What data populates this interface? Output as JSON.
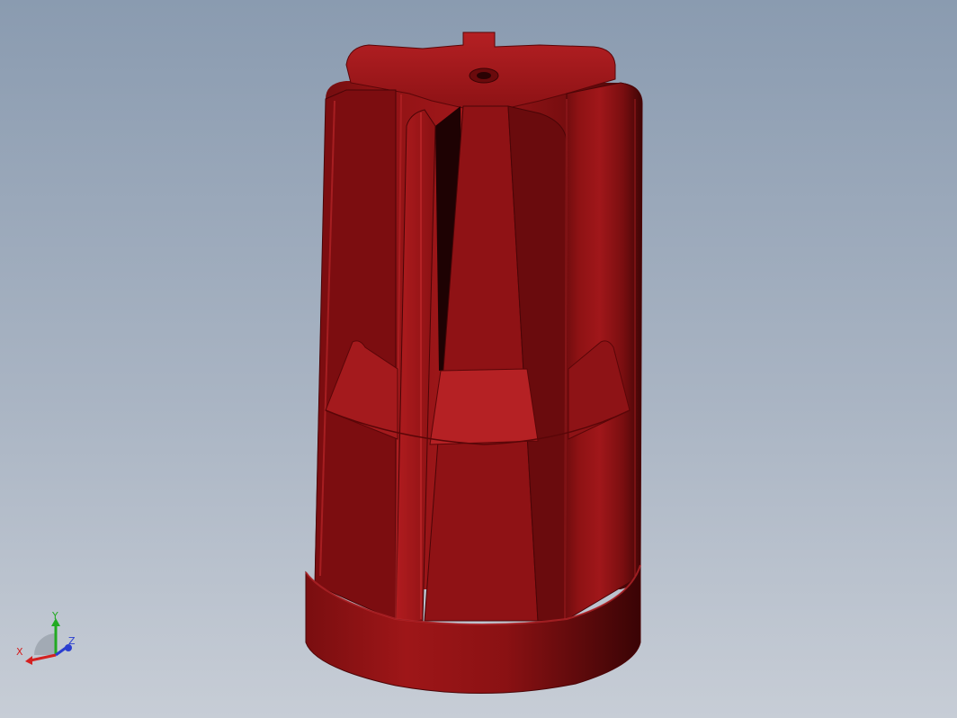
{
  "viewport": {
    "background_top": "#8a9bb0",
    "background_bottom": "#c7cdd6",
    "model": {
      "name": "wire-connector-part",
      "color": "#9b1416"
    }
  },
  "triad": {
    "x_label": "X",
    "y_label": "Y",
    "z_label": "Z",
    "x_color": "#d42020",
    "y_color": "#22aa22",
    "z_color": "#2a3ed0"
  }
}
